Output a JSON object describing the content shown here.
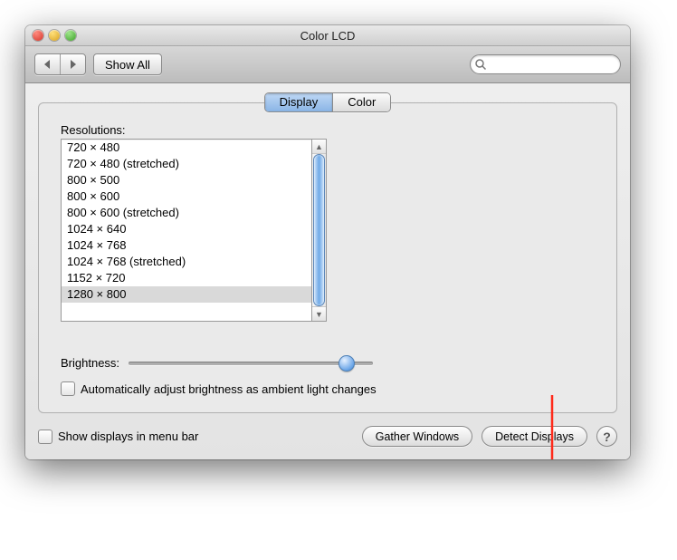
{
  "window": {
    "title": "Color LCD"
  },
  "toolbar": {
    "back_icon": "chevron-left",
    "forward_icon": "chevron-right",
    "show_all_label": "Show All",
    "search_placeholder": ""
  },
  "tabs": {
    "items": [
      "Display",
      "Color"
    ],
    "active_index": 0
  },
  "resolutions": {
    "label": "Resolutions:",
    "items": [
      "720 × 480",
      "720 × 480 (stretched)",
      "800 × 500",
      "800 × 600",
      "800 × 600 (stretched)",
      "1024 × 640",
      "1024 × 768",
      "1024 × 768 (stretched)",
      "1152 × 720",
      "1280 × 800"
    ],
    "selected_index": 9
  },
  "brightness": {
    "label": "Brightness:",
    "value_percent": 92,
    "auto_label": "Automatically adjust brightness as ambient light changes",
    "auto_checked": false
  },
  "footer": {
    "show_menubar_label": "Show displays in menu bar",
    "show_menubar_checked": false,
    "gather_label": "Gather Windows",
    "detect_label": "Detect Displays"
  }
}
